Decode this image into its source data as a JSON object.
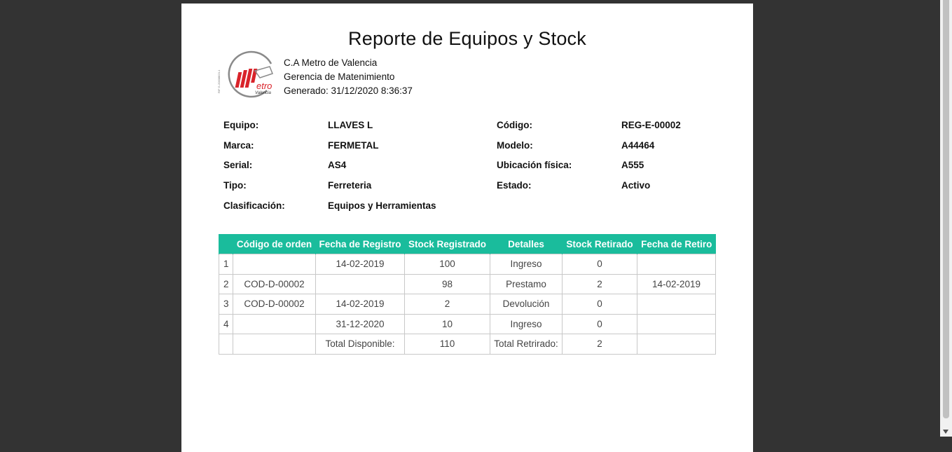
{
  "report": {
    "title": "Reporte de Equipos y Stock",
    "org_name": "C.A Metro de Valencia",
    "department": "Gerencia de Matenimiento",
    "generated": "Generado: 31/12/2020 8:36:37",
    "logo_text": "etro",
    "logo_subtext": "Valencia",
    "logo_rif": "RIF G-20008823-1"
  },
  "equipment": {
    "equipo_label": "Equipo:",
    "equipo_value": "LLAVES L",
    "codigo_label": "Código:",
    "codigo_value": "REG-E-00002",
    "marca_label": "Marca:",
    "marca_value": "FERMETAL",
    "modelo_label": "Modelo:",
    "modelo_value": "A44464",
    "serial_label": "Serial:",
    "serial_value": "AS4",
    "ubicacion_label": "Ubicación física:",
    "ubicacion_value": "A555",
    "tipo_label": "Tipo:",
    "tipo_value": "Ferreteria",
    "estado_label": "Estado:",
    "estado_value": "Activo",
    "clasificacion_label": "Clasificación:",
    "clasificacion_value": "Equipos y Herramientas"
  },
  "table": {
    "headers": [
      "",
      "Código de orden",
      "Fecha de Registro",
      "Stock Registrado",
      "Detalles",
      "Stock Retirado",
      "Fecha de Retiro"
    ],
    "rows": [
      [
        "1",
        "",
        "14-02-2019",
        "100",
        "Ingreso",
        "0",
        ""
      ],
      [
        "2",
        "COD-D-00002",
        "",
        "98",
        "Prestamo",
        "2",
        "14-02-2019"
      ],
      [
        "3",
        "COD-D-00002",
        "14-02-2019",
        "2",
        "Devolución",
        "0",
        ""
      ],
      [
        "4",
        "",
        "31-12-2020",
        "10",
        "Ingreso",
        "0",
        ""
      ]
    ],
    "totals": [
      "",
      "",
      "Total Disponible:",
      "110",
      "Total Retrirado:",
      "2",
      ""
    ]
  },
  "colors": {
    "header_bg": "#1abc9c",
    "viewer_bg": "#333333",
    "logo_red": "#d9232a"
  }
}
